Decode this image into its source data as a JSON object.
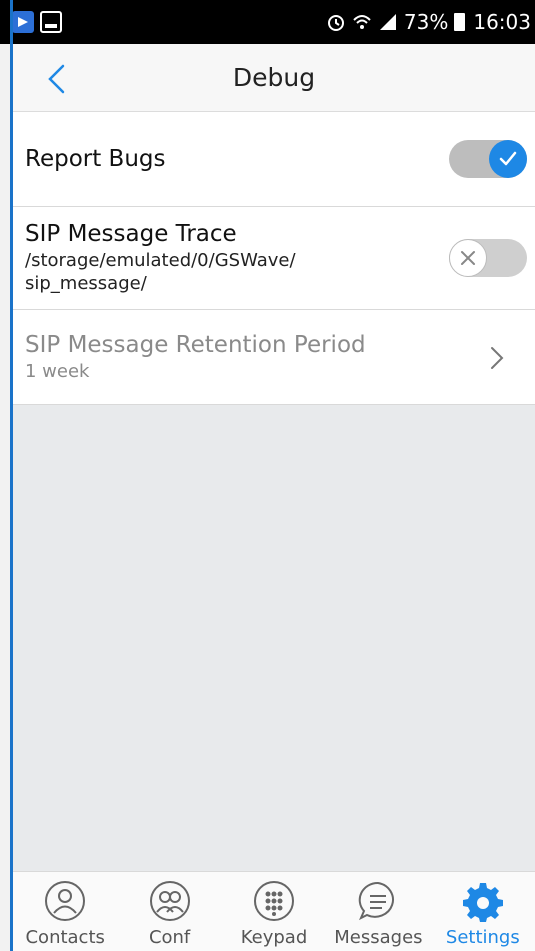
{
  "status_bar": {
    "battery": "73%",
    "time": "16:03"
  },
  "header": {
    "title": "Debug"
  },
  "settings": {
    "report_bugs": {
      "label": "Report Bugs",
      "enabled": true
    },
    "sip_trace": {
      "label": "SIP Message Trace",
      "path": "/storage/emulated/0/GSWave/\nsip_message/",
      "enabled": false
    },
    "retention": {
      "label": "SIP Message Retention Period",
      "value": "1 week"
    }
  },
  "nav": {
    "items": [
      {
        "label": "Contacts",
        "icon": "contacts-icon"
      },
      {
        "label": "Conf",
        "icon": "conference-icon"
      },
      {
        "label": "Keypad",
        "icon": "keypad-icon"
      },
      {
        "label": "Messages",
        "icon": "messages-icon"
      },
      {
        "label": "Settings",
        "icon": "gear-icon",
        "active": true
      }
    ]
  },
  "colors": {
    "accent": "#1e88e5",
    "status_bar": "#000000",
    "background": "#e8eaec"
  }
}
